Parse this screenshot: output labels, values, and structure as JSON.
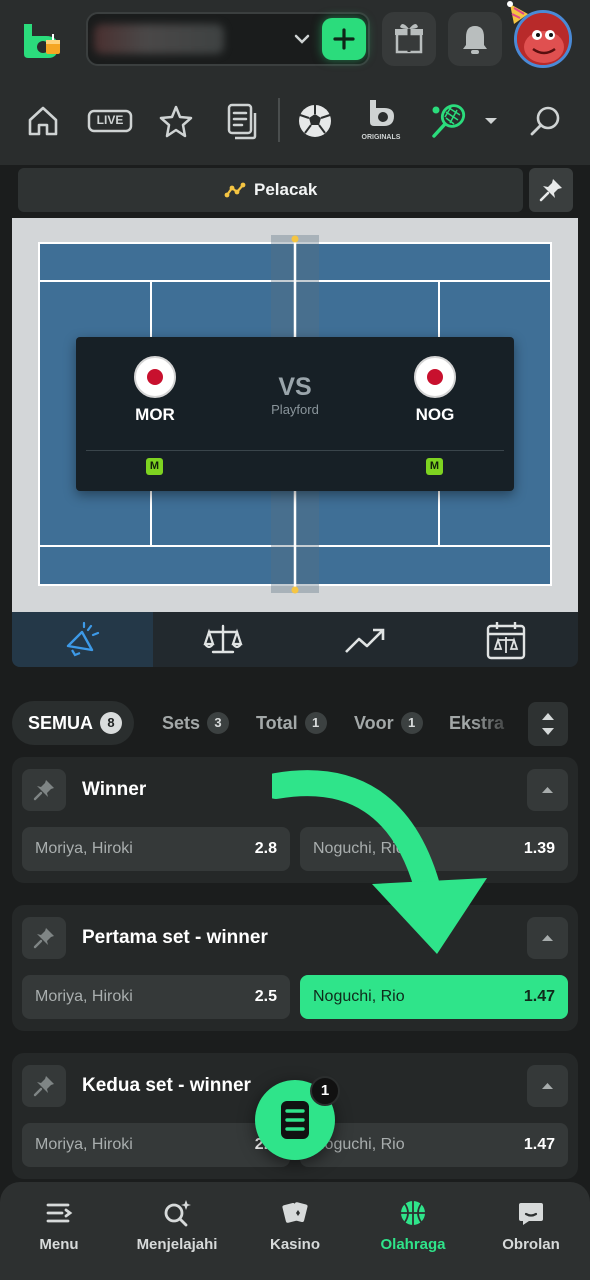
{
  "header": {
    "logo_icon": "bc-game-logo-icon",
    "wallet_dropdown_icon": "chevron-down-icon",
    "deposit_icon": "plus-icon",
    "gift_icon": "gift-icon",
    "notification_icon": "bell-icon",
    "avatar_icon": "avatar-icon",
    "accent_color": "#2bdc7c"
  },
  "top_nav": {
    "live_label": "LIVE",
    "originals_label": "ORIGINALS",
    "items": [
      "home-icon",
      "live-icon",
      "star-icon",
      "betslip-icon",
      "soccer-icon",
      "originals-icon",
      "tennis-icon",
      "search-icon"
    ]
  },
  "tracker": {
    "label": "Pelacak",
    "home_code": "MOR",
    "away_code": "NOG",
    "vs": "VS",
    "venue": "Playford",
    "home_badge": "M",
    "away_badge": "M",
    "court_color": "#3f6f96"
  },
  "filters": [
    {
      "label": "SEMUA",
      "count": "8"
    },
    {
      "label": "Sets",
      "count": "3"
    },
    {
      "label": "Total",
      "count": "1"
    },
    {
      "label": "Voor",
      "count": "1"
    },
    {
      "label": "Ekstra",
      "count": ""
    }
  ],
  "markets": [
    {
      "title": "Winner",
      "home": "Moriya, Hiroki",
      "home_odds": "2.8",
      "away": "Noguchi, Rio",
      "away_odds": "1.39"
    },
    {
      "title": "Pertama set - winner",
      "home": "Moriya, Hiroki",
      "home_odds": "2.5",
      "away": "Noguchi, Rio",
      "away_odds": "1.47"
    },
    {
      "title": "Kedua set - winner",
      "home": "Moriya, Hiroki",
      "home_odds": "2.5",
      "away": "Noguchi, Rio",
      "away_odds": "1.47"
    }
  ],
  "betslip": {
    "count": "1"
  },
  "bottom_nav": {
    "items": [
      {
        "label": "Menu",
        "icon": "menu-icon"
      },
      {
        "label": "Menjelajahi",
        "icon": "explore-icon"
      },
      {
        "label": "Kasino",
        "icon": "cards-icon"
      },
      {
        "label": "Olahraga",
        "icon": "basketball-icon"
      },
      {
        "label": "Obrolan",
        "icon": "chat-icon"
      }
    ],
    "active_color": "#2fe48a"
  }
}
